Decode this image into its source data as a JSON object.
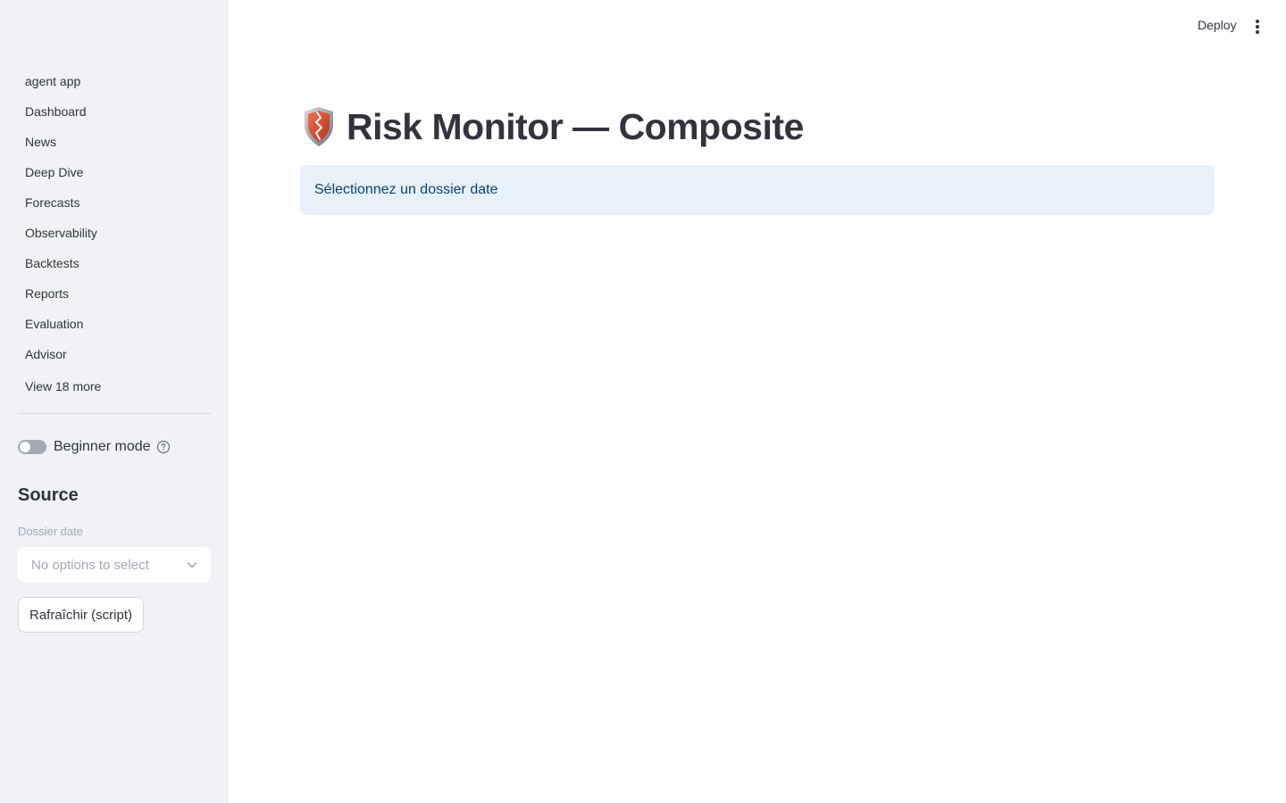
{
  "sidebar": {
    "nav_items": [
      {
        "label": "agent app"
      },
      {
        "label": "Dashboard"
      },
      {
        "label": "News"
      },
      {
        "label": "Deep Dive"
      },
      {
        "label": "Forecasts"
      },
      {
        "label": "Observability"
      },
      {
        "label": "Backtests"
      },
      {
        "label": "Reports"
      },
      {
        "label": "Evaluation"
      },
      {
        "label": "Advisor"
      }
    ],
    "view_more_label": "View 18 more",
    "beginner_toggle": {
      "label": "Beginner mode",
      "checked": false
    },
    "source": {
      "heading": "Source",
      "dossier_label": "Dossier date",
      "dossier_placeholder": "No options to select",
      "refresh_label": "Rafraîchir (script)"
    }
  },
  "header": {
    "deploy_label": "Deploy",
    "menu_icon": "more-vertical-icon"
  },
  "main": {
    "title_icon": "shield-icon",
    "title": "Risk Monitor — Composite",
    "info_message": "Sélectionnez un dossier date"
  },
  "colors": {
    "sidebar_bg": "#f0f2f6",
    "text": "#31333f",
    "info_bg": "#e8f1fa",
    "info_text": "#0e4175",
    "muted": "#a3a8b4"
  }
}
